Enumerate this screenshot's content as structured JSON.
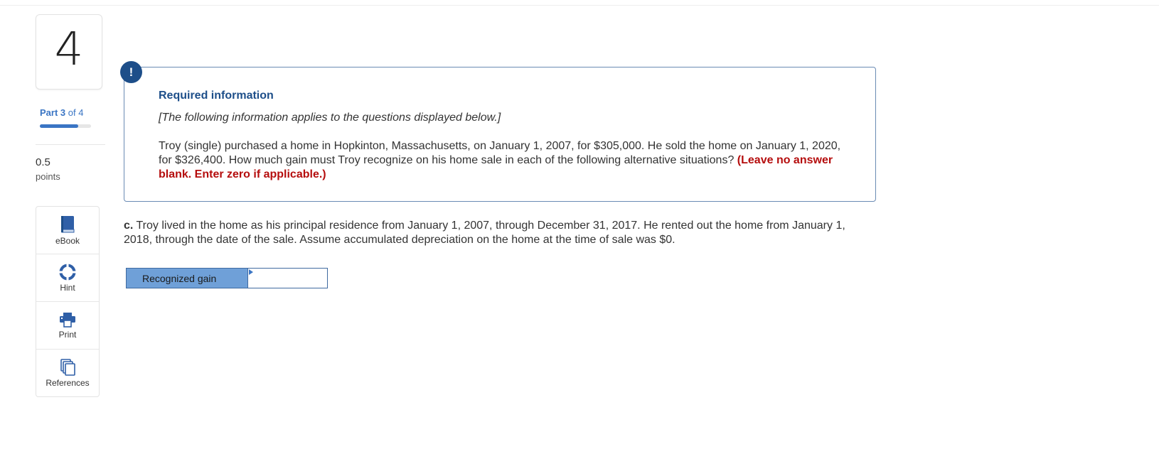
{
  "question": {
    "number": "4",
    "part_label": "Part",
    "part_current": "3",
    "part_of": "of 4",
    "progress_fraction": 0.75,
    "points_value": "0.5",
    "points_label": "points"
  },
  "tools": [
    {
      "label": "eBook",
      "icon": "book-icon"
    },
    {
      "label": "Hint",
      "icon": "lifebuoy-icon"
    },
    {
      "label": "Print",
      "icon": "printer-icon"
    },
    {
      "label": "References",
      "icon": "copy-icon"
    }
  ],
  "info": {
    "badge": "!",
    "title": "Required information",
    "note": "[The following information applies to the questions displayed below.]",
    "body": "Troy (single) purchased a home in Hopkinton, Massachusetts, on January 1, 2007, for $305,000. He sold the home on January 1, 2020, for $326,400. How much gain must Troy recognize on his home sale in each of the following alternative situations?",
    "instruction": "(Leave no answer blank. Enter zero if applicable.)"
  },
  "part_c": {
    "prefix": "c.",
    "text": "Troy lived in the home as his principal residence from January 1, 2007, through December 31, 2017. He rented out the home from January 1, 2018, through the date of the sale. Assume accumulated depreciation on the home at the time of sale was $0."
  },
  "answer": {
    "label": "Recognized gain",
    "value": ""
  },
  "colors": {
    "accent": "#3a75c4",
    "dark_blue": "#1d4e89",
    "warning_red": "#b50d0d",
    "label_fill": "#6fa0d8"
  }
}
